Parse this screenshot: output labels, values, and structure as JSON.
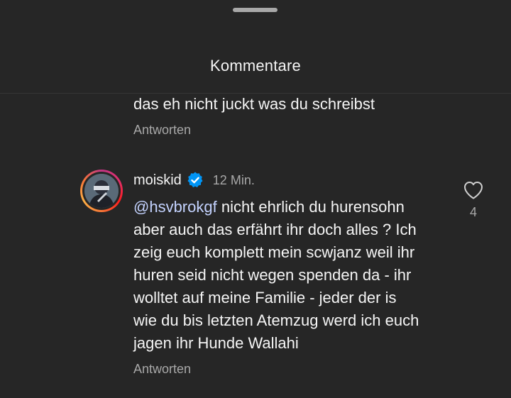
{
  "header": {
    "title": "Kommentare"
  },
  "previous_comment": {
    "text_tail": "das eh nicht juckt was du schreibst",
    "reply_label": "Antworten"
  },
  "comment": {
    "username": "moiskid",
    "verified": true,
    "time": "12 Min.",
    "mention": "@hsvbrokgf",
    "lines": [
      " nicht ehrlich du hurensohn",
      "aber auch das erfährt ihr doch alles ? Ich",
      "zeig euch komplett mein scwjanz weil ihr",
      "huren seid nicht wegen spenden da - ihr",
      "wolltet auf meine Familie - jeder der is",
      "wie du bis letzten Atemzug werd ich euch",
      "jagen ihr Hunde Wallahi"
    ],
    "like_count": "4",
    "reply_label": "Antworten"
  },
  "colors": {
    "background": "#262626",
    "text": "#f5f5f5",
    "secondary_text": "#a8a8a8",
    "mention": "#c4d3ff",
    "verified_badge": "#0095f6"
  },
  "icons": {
    "verified": "verified-badge-icon",
    "like": "heart-outline-icon"
  }
}
